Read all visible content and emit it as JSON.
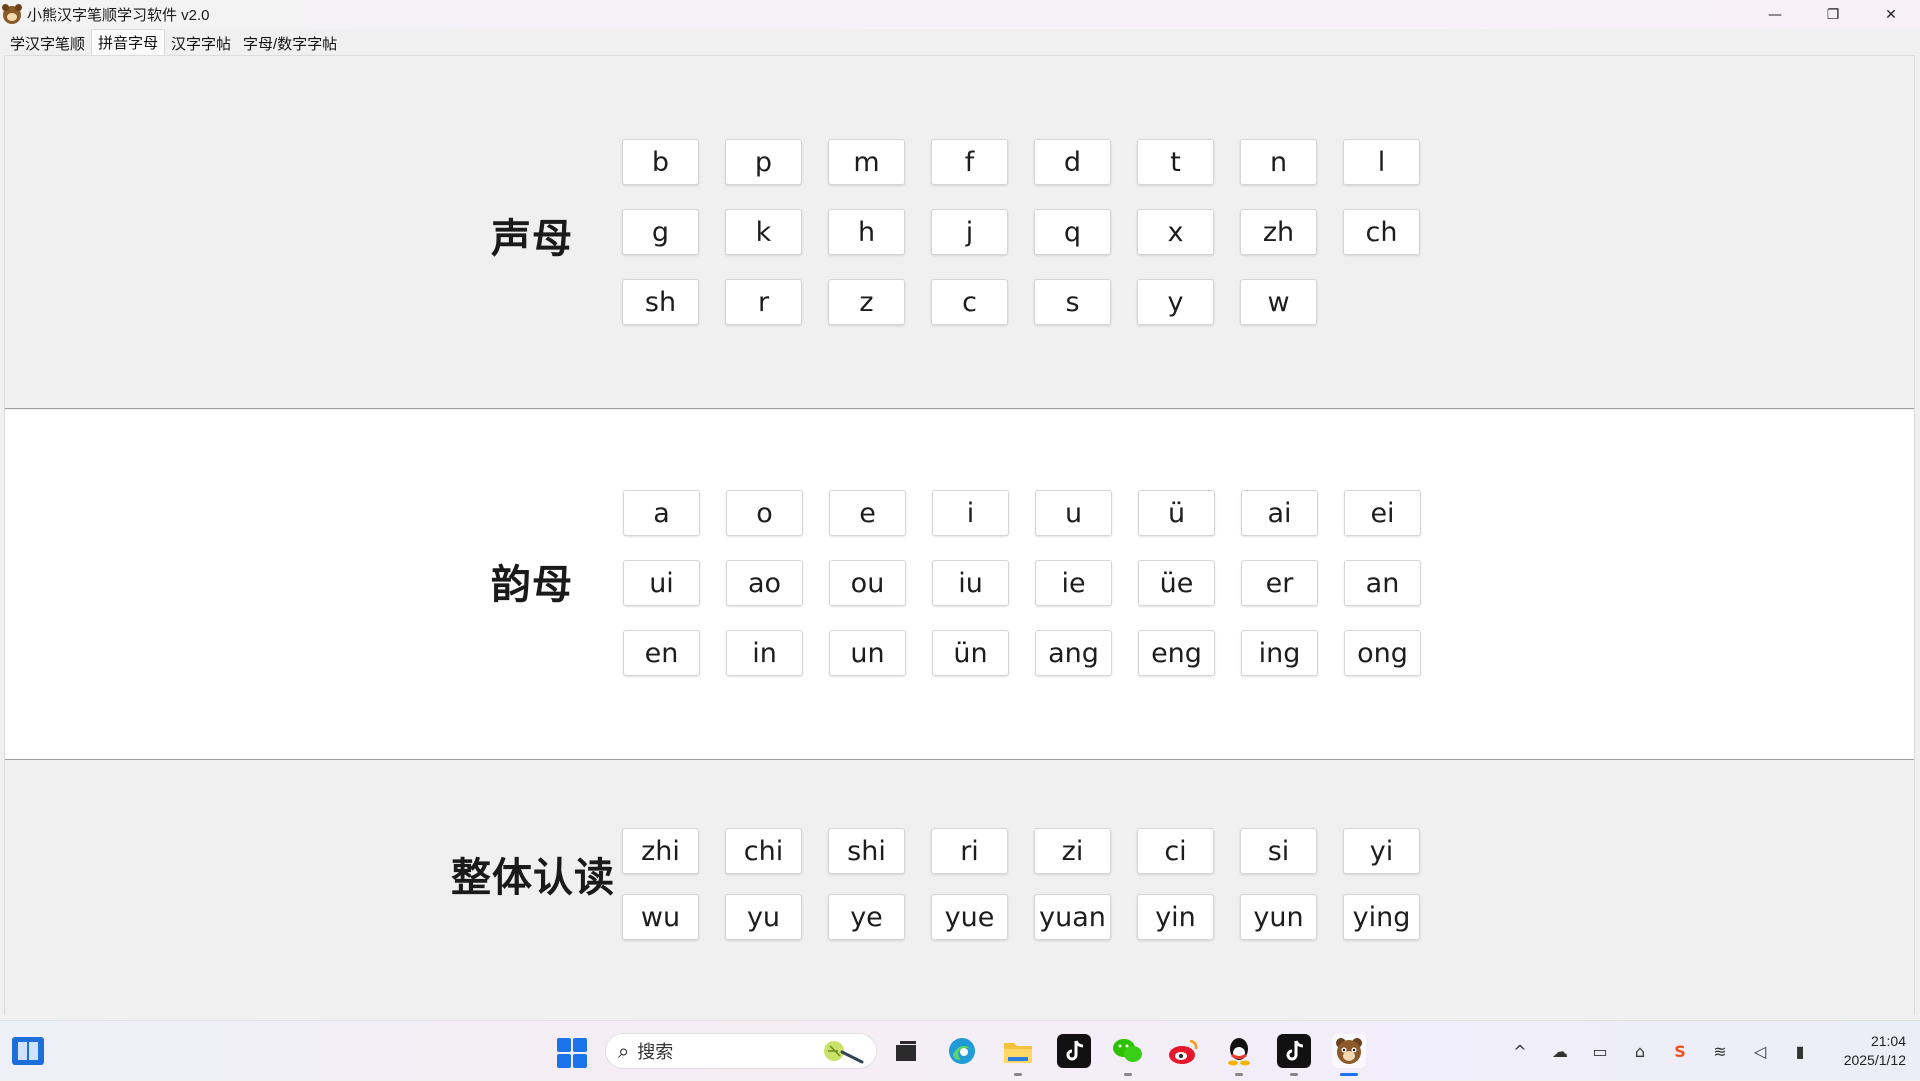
{
  "window": {
    "title": "小熊汉字笔顺学习软件 v2.0",
    "controls": {
      "minimize": "—",
      "restore": "❐",
      "close": "✕"
    }
  },
  "tabs": [
    {
      "label": "学汉字笔顺",
      "active": false
    },
    {
      "label": "拼音字母",
      "active": true
    },
    {
      "label": "汉字字帖",
      "active": false
    },
    {
      "label": "字母/数字字帖",
      "active": false
    }
  ],
  "sections": {
    "initials": {
      "label": "声母",
      "keys": [
        "b",
        "p",
        "m",
        "f",
        "d",
        "t",
        "n",
        "l",
        "g",
        "k",
        "h",
        "j",
        "q",
        "x",
        "zh",
        "ch",
        "sh",
        "r",
        "z",
        "c",
        "s",
        "y",
        "w"
      ]
    },
    "finals": {
      "label": "韵母",
      "keys": [
        "a",
        "o",
        "e",
        "i",
        "u",
        "ü",
        "ai",
        "ei",
        "ui",
        "ao",
        "ou",
        "iu",
        "ie",
        "üe",
        "er",
        "an",
        "en",
        "in",
        "un",
        "ün",
        "ang",
        "eng",
        "ing",
        "ong"
      ]
    },
    "whole": {
      "label": "整体认读",
      "keys": [
        "zhi",
        "chi",
        "shi",
        "ri",
        "zi",
        "ci",
        "si",
        "yi",
        "wu",
        "yu",
        "ye",
        "yue",
        "yuan",
        "yin",
        "yun",
        "ying"
      ]
    }
  },
  "taskbar": {
    "search_placeholder": "搜索",
    "apps": [
      "task-view",
      "edge",
      "file-explorer",
      "douyin",
      "wechat",
      "weibo",
      "qq",
      "douyin-2",
      "xiaoxiong-app"
    ],
    "clock": {
      "time": "21:04",
      "date": "2025/1/12"
    },
    "tray_icons": [
      "chevron-up-icon",
      "cloud-sync-icon",
      "display-icon",
      "ime-icon",
      "sogou-icon",
      "wifi-icon",
      "speaker-icon",
      "battery-icon"
    ],
    "accent": "#1a73e8"
  }
}
